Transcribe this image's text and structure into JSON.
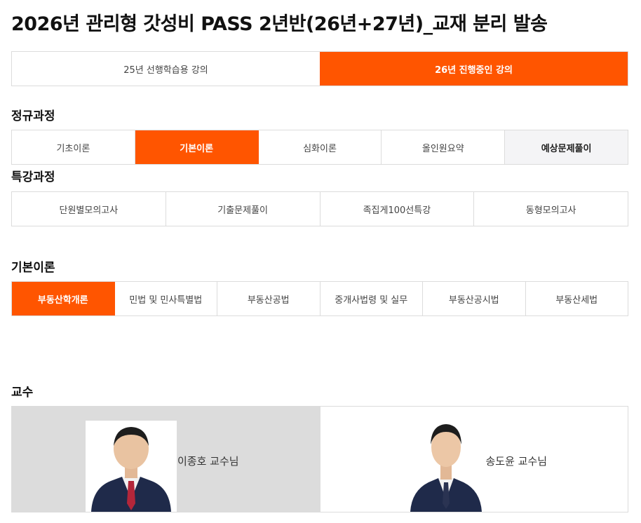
{
  "page_title": "2026년 관리형 갓성비 PASS 2년반(26년+27년)_교재 분리 발송",
  "year_tabs": [
    {
      "label": "25년 선행학습용 강의"
    },
    {
      "label": "26년 진행중인 강의"
    }
  ],
  "regular_course": {
    "heading": "정규과정",
    "items": [
      {
        "label": "기초이론"
      },
      {
        "label": "기본이론"
      },
      {
        "label": "심화이론"
      },
      {
        "label": "올인원요약"
      },
      {
        "label": "예상문제풀이"
      }
    ]
  },
  "special_course": {
    "heading": "특강과정",
    "items": [
      {
        "label": "단원별모의고사"
      },
      {
        "label": "기출문제풀이"
      },
      {
        "label": "족집게100선특강"
      },
      {
        "label": "동형모의고사"
      }
    ]
  },
  "subjects": {
    "heading": "기본이론",
    "items": [
      {
        "label": "부동산학개론"
      },
      {
        "label": "민법 및 민사특별법"
      },
      {
        "label": "부동산공법"
      },
      {
        "label": "중개사법령 및 실무"
      },
      {
        "label": "부동산공시법"
      },
      {
        "label": "부동산세법"
      }
    ]
  },
  "professors": {
    "heading": "교수",
    "items": [
      {
        "name": "이종호 교수님"
      },
      {
        "name": "송도윤 교수님"
      }
    ]
  },
  "colors": {
    "accent": "#ff5500",
    "border": "#dcdcdc",
    "selected_card": "#dcdcdc",
    "suit": "#1f2a4a"
  }
}
